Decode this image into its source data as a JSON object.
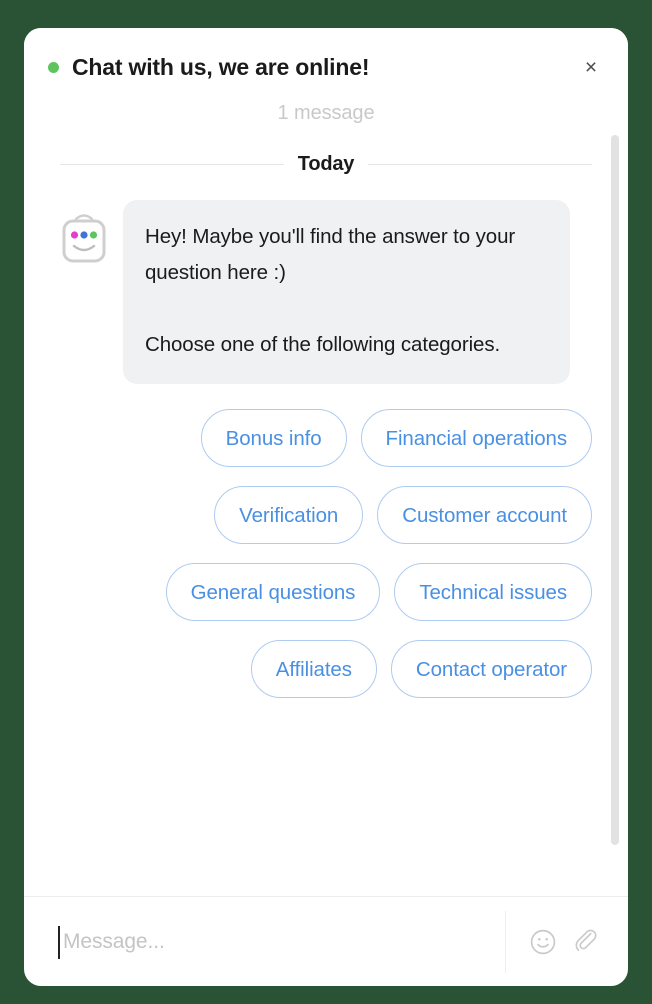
{
  "page": {
    "background_color": "#2a5335"
  },
  "widget": {
    "card_background": "#ffffff",
    "header": {
      "title": "Chat with us, we are online!",
      "status_dot_color": "#5cc65c",
      "status_dot_name": "online-status-dot",
      "close_label": "×",
      "message_count": "1 message"
    },
    "body": {
      "date_divider_label": "Today",
      "avatar_icon": "robot-avatar-icon",
      "avatar_dot_colors": [
        "#e040d0",
        "#3f74d8",
        "#5cc65c"
      ],
      "bubble": {
        "background_color": "#eff1f3",
        "paragraphs": [
          "Hey! Maybe you'll find the answer to your question here :)",
          "Choose one of the following categories."
        ]
      },
      "quick_replies": {
        "text_color": "#4a90e2",
        "border_color": "#aecbf0",
        "rows": [
          [
            "Bonus info",
            "Financial operations"
          ],
          [
            "Verification",
            "Customer account"
          ],
          [
            "General questions",
            "Technical issues"
          ],
          [
            "Affiliates",
            "Contact operator"
          ]
        ]
      },
      "scrollbar": {
        "thumb_color": "#e2e2e2"
      }
    },
    "composer": {
      "input_value": "",
      "input_placeholder": "Message...",
      "emoji_icon": "smiley-icon",
      "attach_icon": "paperclip-icon"
    }
  }
}
